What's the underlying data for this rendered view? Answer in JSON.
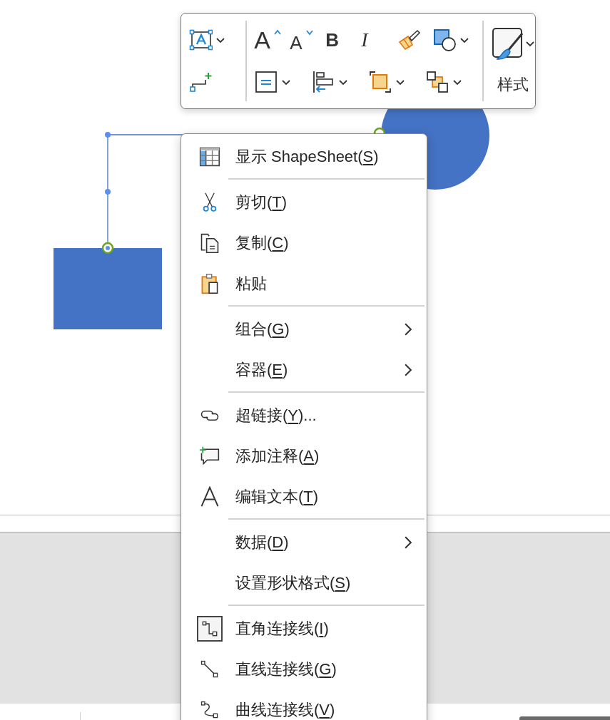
{
  "canvas": {
    "connector": {
      "selected": true
    }
  },
  "toolbar": {
    "column_1": [
      {
        "kind": "textbox",
        "dropdown": true
      },
      {
        "kind": "connector",
        "dropdown": false
      }
    ],
    "row_1": [
      {
        "kind": "grow_font",
        "glyph": "A",
        "dropdown": false
      },
      {
        "kind": "shrink_font",
        "glyph": "A",
        "dropdown": false
      },
      {
        "kind": "bold",
        "glyph": "B",
        "dropdown": false
      },
      {
        "kind": "italic",
        "glyph": "I",
        "dropdown": false
      },
      {
        "kind": "format_painter",
        "dropdown": false
      },
      {
        "kind": "shape_style",
        "dropdown": true
      }
    ],
    "row_2": [
      {
        "kind": "text_align",
        "dropdown": true
      },
      {
        "kind": "position",
        "dropdown": true
      },
      {
        "kind": "bring_forward",
        "dropdown": true
      },
      {
        "kind": "arrange",
        "dropdown": true
      }
    ],
    "style": {
      "label": "样式",
      "dropdown": true
    }
  },
  "context_menu": {
    "items": [
      {
        "kind": "shapesheet",
        "prefix": "显示 ShapeSheet(",
        "key": "S",
        "suffix": ")",
        "submenu": false,
        "checked": false
      },
      {
        "kind": "separator"
      },
      {
        "kind": "cut",
        "prefix": "剪切(",
        "key": "T",
        "suffix": ")",
        "submenu": false,
        "checked": false
      },
      {
        "kind": "copy",
        "prefix": "复制(",
        "key": "C",
        "suffix": ")",
        "submenu": false,
        "checked": false
      },
      {
        "kind": "paste",
        "prefix": "粘贴",
        "submenu": false,
        "checked": false
      },
      {
        "kind": "separator"
      },
      {
        "kind": "plain",
        "prefix": "组合(",
        "key": "G",
        "suffix": ")",
        "submenu": true,
        "checked": false
      },
      {
        "kind": "plain",
        "prefix": "容器(",
        "key": "E",
        "suffix": ")",
        "submenu": true,
        "checked": false
      },
      {
        "kind": "separator"
      },
      {
        "kind": "link",
        "prefix": "超链接(",
        "key": "Y",
        "suffix": ")...",
        "submenu": false,
        "checked": false
      },
      {
        "kind": "comment",
        "prefix": "添加注释(",
        "key": "A",
        "suffix": ")",
        "submenu": false,
        "checked": false
      },
      {
        "kind": "edit_text",
        "prefix": "编辑文本(",
        "key": "T",
        "suffix": ")",
        "submenu": false,
        "checked": false
      },
      {
        "kind": "separator"
      },
      {
        "kind": "plain",
        "prefix": "数据(",
        "key": "D",
        "suffix": ")",
        "submenu": true,
        "checked": false
      },
      {
        "kind": "plain",
        "prefix": "设置形状格式(",
        "key": "S",
        "suffix": ")",
        "submenu": false,
        "checked": false
      },
      {
        "kind": "separator"
      },
      {
        "kind": "right_angle",
        "prefix": "直角连接线(",
        "key": "I",
        "suffix": ")",
        "submenu": false,
        "checked": true
      },
      {
        "kind": "straight",
        "prefix": "直线连接线(",
        "key": "G",
        "suffix": ")",
        "submenu": false,
        "checked": false
      },
      {
        "kind": "curved",
        "prefix": "曲线连接线(",
        "key": "V",
        "suffix": ")",
        "submenu": false,
        "checked": false
      }
    ]
  }
}
